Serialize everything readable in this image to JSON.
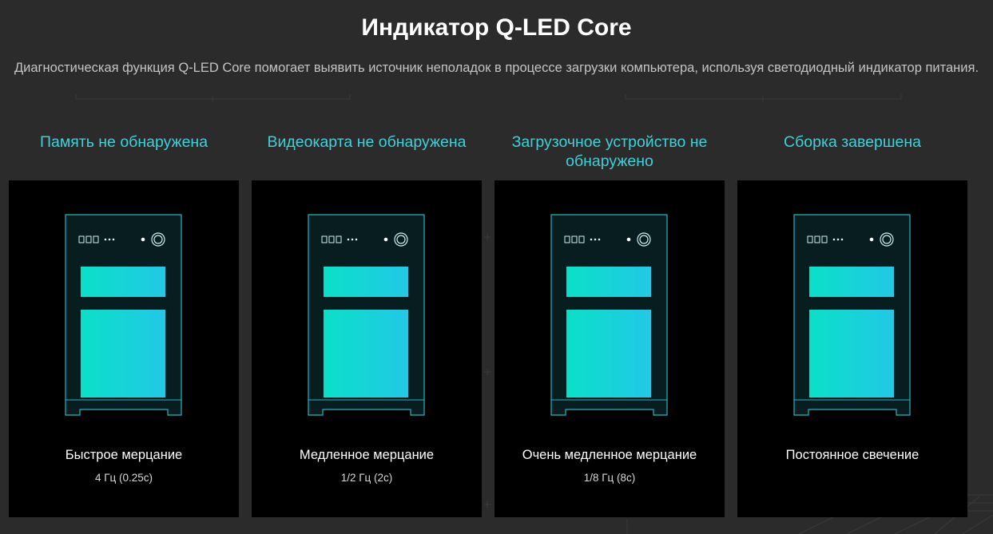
{
  "page": {
    "title": "Индикатор Q-LED Core",
    "description": "Диагностическая функция Q-LED Core помогает выявить источник неполадок в процессе загрузки компьютера, используя светодиодный индикатор питания."
  },
  "colors": {
    "background": "#2b2b2c",
    "heading_accent": "#3fd0d8",
    "card_background": "#000000",
    "panel_gradient_start": "#0ae0c8",
    "panel_gradient_end": "#22c8e6",
    "case_outline": "#1fb5c4"
  },
  "cards": [
    {
      "heading": "Память не обнаружена",
      "mode": "Быстрое мерцание",
      "frequency": "4 Гц (0.25с)",
      "icon": "pc-case-icon"
    },
    {
      "heading": "Видеокарта не обнаружена",
      "mode": "Медленное мерцание",
      "frequency": "1/2 Гц (2с)",
      "icon": "pc-case-icon"
    },
    {
      "heading": "Загрузочное устройство не обнаружено",
      "mode": "Очень медленное мерцание",
      "frequency": "1/8 Гц (8с)",
      "icon": "pc-case-icon"
    },
    {
      "heading": "Сборка завершена",
      "mode": "Постоянное свечение",
      "frequency": "",
      "icon": "pc-case-icon"
    }
  ]
}
